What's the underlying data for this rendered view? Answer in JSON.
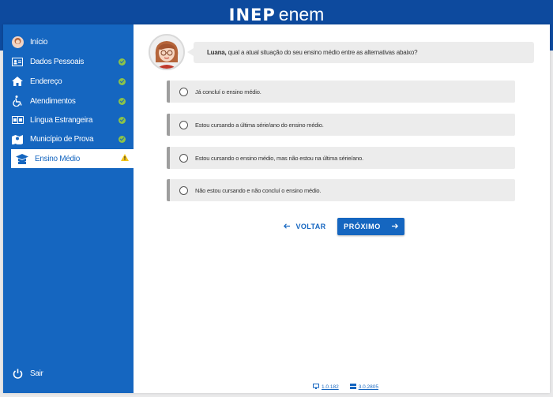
{
  "header": {
    "logo_inep": "INEP",
    "logo_enem": "enem"
  },
  "sidebar": {
    "items": [
      {
        "label": "Início",
        "icon": "avatar-icon",
        "status": "none"
      },
      {
        "label": "Dados Pessoais",
        "icon": "id-card-icon",
        "status": "complete"
      },
      {
        "label": "Endereço",
        "icon": "home-icon",
        "status": "complete"
      },
      {
        "label": "Atendimentos",
        "icon": "wheelchair-icon",
        "status": "complete"
      },
      {
        "label": "Língua Estrangeira",
        "icon": "language-icon",
        "status": "complete"
      },
      {
        "label": "Município de Prova",
        "icon": "map-icon",
        "status": "complete"
      },
      {
        "label": "Ensino Médio",
        "icon": "graduation-icon",
        "status": "warning"
      }
    ],
    "logout_label": "Sair"
  },
  "question": {
    "name": "Luana,",
    "text": "qual a atual situação do seu ensino médio entre as alternativas abaixo?"
  },
  "options": [
    {
      "label": "Já concluí o ensino médio."
    },
    {
      "label": "Estou cursando a última série/ano do ensino médio."
    },
    {
      "label": "Estou cursando o ensino médio, mas não estou na última série/ano."
    },
    {
      "label": "Não estou cursando e não concluí o ensino médio."
    }
  ],
  "buttons": {
    "back": "VOLTAR",
    "next": "PRÓXIMO"
  },
  "footer": {
    "version_front": "1.0.182",
    "version_back": "3.0.2805"
  },
  "colors": {
    "primary": "#1566c0",
    "header": "#0d4a9e",
    "check": "#8bc34a",
    "warning": "#f5c518"
  }
}
